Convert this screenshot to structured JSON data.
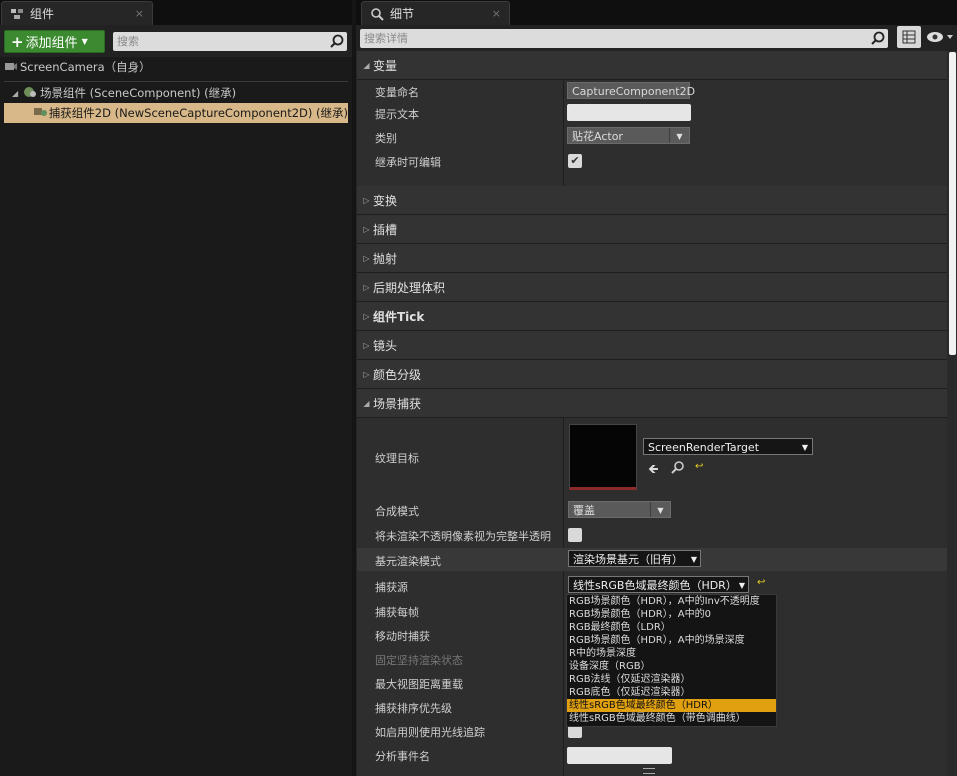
{
  "left_panel": {
    "tab_title": "组件",
    "tab_close": "×",
    "add_button_label": "添加组件",
    "search_placeholder": "搜索",
    "root_item": "ScreenCamera（自身）",
    "tree": [
      {
        "label": "场景组件 (SceneComponent) (继承)",
        "expanded": true
      },
      {
        "label": "捕获组件2D (NewSceneCaptureComponent2D) (继承)",
        "selected": true
      }
    ]
  },
  "right_panel": {
    "tab_title": "细节",
    "tab_close": "×",
    "search_placeholder": "搜索详情",
    "categories": {
      "variables": "变量",
      "transform": "变换",
      "sockets": "插槽",
      "projectile": "抛射",
      "postprocess": "后期处理体积",
      "component_tick": "组件Tick",
      "lens": "镜头",
      "color_grading": "颜色分级",
      "scene_capture": "场景捕获"
    },
    "variables": {
      "name_label": "变量命名",
      "name_value": "CaptureComponent2D",
      "tooltip_label": "提示文本",
      "tooltip_value": "",
      "category_label": "类别",
      "category_value": "贴花Actor",
      "editable_label": "继承时可编辑",
      "editable_checked": "✔"
    },
    "scene_capture": {
      "texture_target_label": "纹理目标",
      "texture_target_value": "ScreenRenderTarget",
      "composite_mode_label": "合成模式",
      "composite_mode_value": "覆盖",
      "treat_unrendered_label": "将未渲染不透明像素视为完整半透明",
      "primitive_render_label": "基元渲染模式",
      "primitive_render_value": "渲染场景基元（旧有）",
      "capture_source_label": "捕获源",
      "capture_source_value": "线性sRGB色域最终颜色（HDR）",
      "capture_every_frame_label": "捕获每帧",
      "capture_on_movement_label": "移动时捕获",
      "persist_rendering_state_label": "固定坚持渲染状态",
      "max_view_distance_label": "最大视图距离重载",
      "capture_sort_priority_label": "捕获排序优先级",
      "use_raytracing_label": "如启用则使用光线追踪",
      "profiling_event_label": "分析事件名"
    },
    "capture_source_options": [
      "RGB场景颜色（HDR），A中的Inv不透明度",
      "RGB场景颜色（HDR），A中的0",
      "RGB最终颜色（LDR）",
      "RGB场景颜色（HDR），A中的场景深度",
      "R中的场景深度",
      "设备深度（RGB）",
      "RGB法线（仅延迟渲染器）",
      "RGB底色（仅延迟渲染器）",
      "线性sRGB色域最终颜色（HDR）",
      "线性sRGB色域最终颜色（带色调曲线）"
    ],
    "selected_option_index": 8
  },
  "colors": {
    "accent_green": "#3c8a2f",
    "selection_tan": "#d8b888",
    "dropdown_highlight": "#e0a010"
  }
}
